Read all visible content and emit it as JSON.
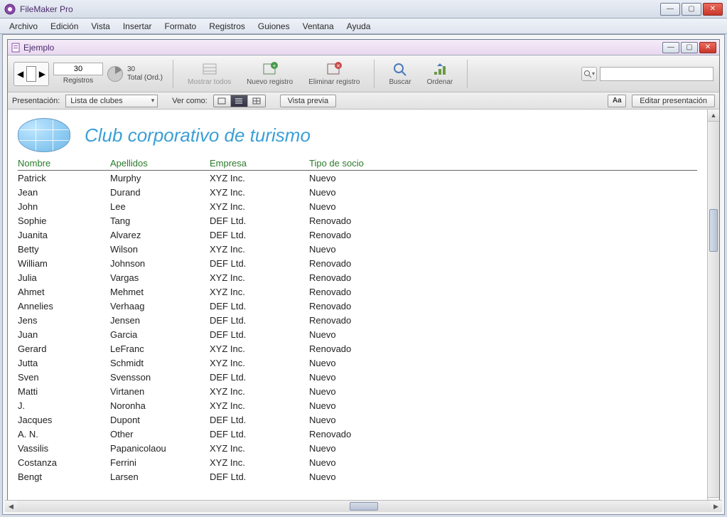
{
  "app": {
    "title": "FileMaker Pro"
  },
  "menu": [
    "Archivo",
    "Edición",
    "Vista",
    "Insertar",
    "Formato",
    "Registros",
    "Guiones",
    "Ventana",
    "Ayuda"
  ],
  "doc": {
    "title": "Ejemplo"
  },
  "toolbar": {
    "record_number": "30",
    "records_label": "Registros",
    "total_count": "30",
    "total_label": "Total (Ord.)",
    "show_all": "Mostrar todos",
    "new_record": "Nuevo registro",
    "delete_record": "Eliminar registro",
    "find": "Buscar",
    "sort": "Ordenar"
  },
  "formatbar": {
    "layout_label": "Presentación:",
    "layout_value": "Lista de clubes",
    "view_as_label": "Ver como:",
    "preview": "Vista previa",
    "aa": "Aa",
    "edit_layout": "Editar presentación"
  },
  "header": {
    "title": "Club corporativo de turismo"
  },
  "columns": [
    "Nombre",
    "Apellidos",
    "Empresa",
    "Tipo de socio"
  ],
  "rows": [
    [
      "Patrick",
      "Murphy",
      "XYZ Inc.",
      "Nuevo"
    ],
    [
      "Jean",
      "Durand",
      "XYZ Inc.",
      "Nuevo"
    ],
    [
      "John",
      "Lee",
      "XYZ Inc.",
      "Nuevo"
    ],
    [
      "Sophie",
      "Tang",
      "DEF Ltd.",
      "Renovado"
    ],
    [
      "Juanita",
      "Alvarez",
      "DEF Ltd.",
      "Renovado"
    ],
    [
      "Betty",
      "Wilson",
      "XYZ Inc.",
      "Nuevo"
    ],
    [
      "William",
      "Johnson",
      "DEF Ltd.",
      "Renovado"
    ],
    [
      "Julia",
      "Vargas",
      "XYZ Inc.",
      "Renovado"
    ],
    [
      "Ahmet",
      "Mehmet",
      "XYZ Inc.",
      "Renovado"
    ],
    [
      "Annelies",
      "Verhaag",
      "DEF Ltd.",
      "Renovado"
    ],
    [
      "Jens",
      "Jensen",
      "DEF Ltd.",
      "Renovado"
    ],
    [
      "Juan",
      "Garcia",
      "DEF Ltd.",
      "Nuevo"
    ],
    [
      "Gerard",
      "LeFranc",
      "XYZ Inc.",
      "Renovado"
    ],
    [
      "Jutta",
      "Schmidt",
      "XYZ Inc.",
      "Nuevo"
    ],
    [
      "Sven",
      "Svensson",
      "DEF Ltd.",
      "Nuevo"
    ],
    [
      "Matti",
      "Virtanen",
      "XYZ Inc.",
      "Nuevo"
    ],
    [
      "J.",
      "Noronha",
      "XYZ Inc.",
      "Nuevo"
    ],
    [
      "Jacques",
      "Dupont",
      "DEF Ltd.",
      "Nuevo"
    ],
    [
      "A. N.",
      "Other",
      "DEF Ltd.",
      "Renovado"
    ],
    [
      "Vassilis",
      "Papanicolaou",
      "XYZ Inc.",
      "Nuevo"
    ],
    [
      "Costanza",
      "Ferrini",
      "XYZ Inc.",
      "Nuevo"
    ],
    [
      "Bengt",
      "Larsen",
      "DEF Ltd.",
      "Nuevo"
    ]
  ]
}
